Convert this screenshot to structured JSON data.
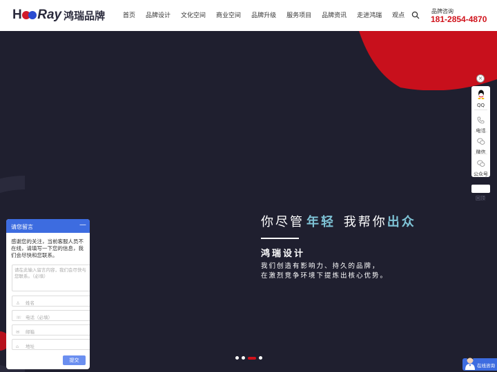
{
  "logo": {
    "h": "H",
    "ray": "Ray",
    "cn": "鸿瑞品牌"
  },
  "nav": {
    "items": [
      {
        "label": "首页"
      },
      {
        "label": "品牌设计"
      },
      {
        "label": "文化空间"
      },
      {
        "label": "商业空间"
      },
      {
        "label": "品牌升级"
      },
      {
        "label": "服务项目"
      },
      {
        "label": "品牌资讯"
      },
      {
        "label": "走进鸿瑞"
      },
      {
        "label": "观点"
      }
    ],
    "search_icon": "search-icon"
  },
  "hotline": {
    "label": "品牌咨询",
    "phone": "181-2854-4870"
  },
  "hero": {
    "slogan_a": "你尽管",
    "slogan_b": "年轻",
    "slogan_c": "我帮你",
    "slogan_d": "出众",
    "title": "鸿瑞设计",
    "desc_line1": "我们创造有影响力、持久的品牌，",
    "desc_line2": "在激烈竞争环境下提炼出核心优势。",
    "slides": 4,
    "active_slide": 3
  },
  "sidebar": {
    "close": "×",
    "items": [
      {
        "label": "QQ",
        "icon": "qq-icon"
      },
      {
        "label": "电话",
        "icon": "phone-icon"
      },
      {
        "label": "微信",
        "icon": "wechat-icon"
      },
      {
        "label": "公众号",
        "icon": "official-account-icon"
      }
    ],
    "top_label": "回顶"
  },
  "message": {
    "title": "请您留言",
    "minimize": "—",
    "note": "感谢您的关注，当前客服人员不在线，请填写一下您的信息，我们会尽快和您联系。",
    "textarea_placeholder": "请在此输入留言内容，我们会尽快与您联系。（必填）",
    "fields": [
      {
        "placeholder": "姓名",
        "icon": "user-icon"
      },
      {
        "placeholder": "电话（必填）",
        "icon": "phone-icon"
      },
      {
        "placeholder": "邮箱",
        "icon": "mail-icon"
      },
      {
        "placeholder": "地址",
        "icon": "location-icon"
      }
    ],
    "submit": "提交"
  },
  "chat": {
    "label": "在线咨询"
  },
  "colors": {
    "brand_red": "#d0121b",
    "hero_bg": "#1f1f2f",
    "accent_cyan": "#7ec3d6",
    "panel_blue": "#3d6ce0"
  }
}
